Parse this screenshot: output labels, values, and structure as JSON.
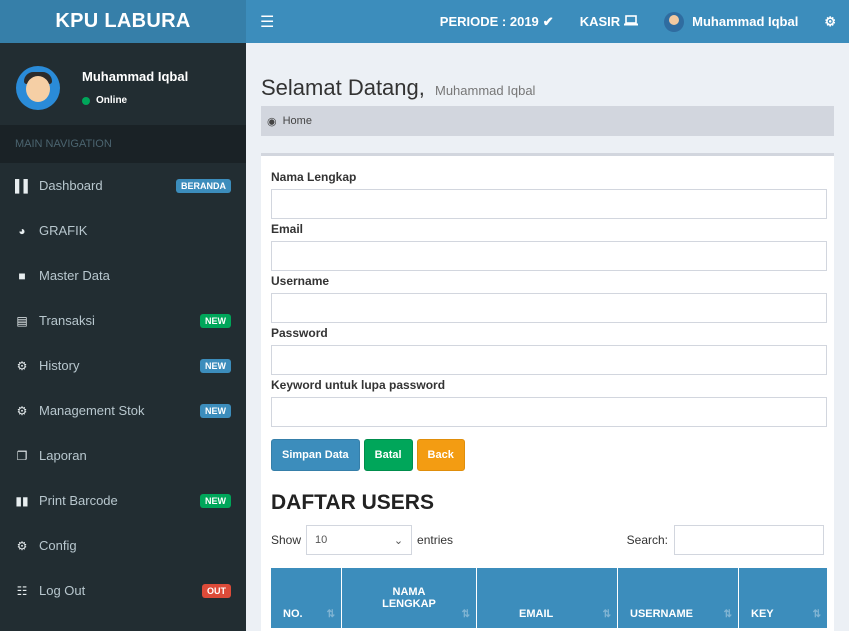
{
  "header": {
    "logo": "KPU LABURA",
    "menu_icon": "bars-icon",
    "periode": "PERIODE : 2019",
    "kasir": "KASIR",
    "user": "Muhammad Iqbal"
  },
  "sidebar": {
    "user_name": "Muhammad Iqbal",
    "user_status": "Online",
    "header": "MAIN NAVIGATION",
    "items": [
      {
        "label": "Dashboard",
        "icon": "bar-chart-icon",
        "badge": "BERANDA",
        "badge_color": "#3c8dbc"
      },
      {
        "label": "GRAFIK",
        "icon": "pie-chart-icon",
        "badge": "",
        "badge_color": ""
      },
      {
        "label": "Master Data",
        "icon": "folder-icon",
        "badge": "",
        "badge_color": ""
      },
      {
        "label": "Transaksi",
        "icon": "card-icon",
        "badge": "NEW",
        "badge_color": "#00a65a"
      },
      {
        "label": "History",
        "icon": "gears-icon",
        "badge": "NEW",
        "badge_color": "#3c8dbc"
      },
      {
        "label": "Management Stok",
        "icon": "gears-icon",
        "badge": "NEW",
        "badge_color": "#3c8dbc"
      },
      {
        "label": "Laporan",
        "icon": "copy-icon",
        "badge": "",
        "badge_color": ""
      },
      {
        "label": "Print Barcode",
        "icon": "barcode-icon",
        "badge": "NEW",
        "badge_color": "#00a65a"
      },
      {
        "label": "Config",
        "icon": "gears-icon",
        "badge": "",
        "badge_color": ""
      },
      {
        "label": "Log Out",
        "icon": "list-icon",
        "badge": "OUT",
        "badge_color": "#dd4b39"
      }
    ]
  },
  "main": {
    "title": "Selamat Datang,",
    "subtitle": "Muhammad Iqbal",
    "breadcrumb": "Home",
    "form": {
      "nama_label": "Nama Lengkap",
      "email_label": "Email",
      "username_label": "Username",
      "password_label": "Password",
      "keyword_label": "Keyword untuk lupa password",
      "nama_value": "",
      "email_value": "",
      "username_value": "",
      "password_value": "",
      "keyword_value": ""
    },
    "buttons": {
      "save": "Simpan Data",
      "cancel": "Batal",
      "back": "Back"
    },
    "section_title": "DAFTAR USERS",
    "table": {
      "show": "Show",
      "entries_value": "10",
      "entries": "entries",
      "search": "Search:",
      "columns": [
        "NO.",
        "NAMA LENGKAP",
        "EMAIL",
        "USERNAME",
        "KEY"
      ]
    }
  }
}
